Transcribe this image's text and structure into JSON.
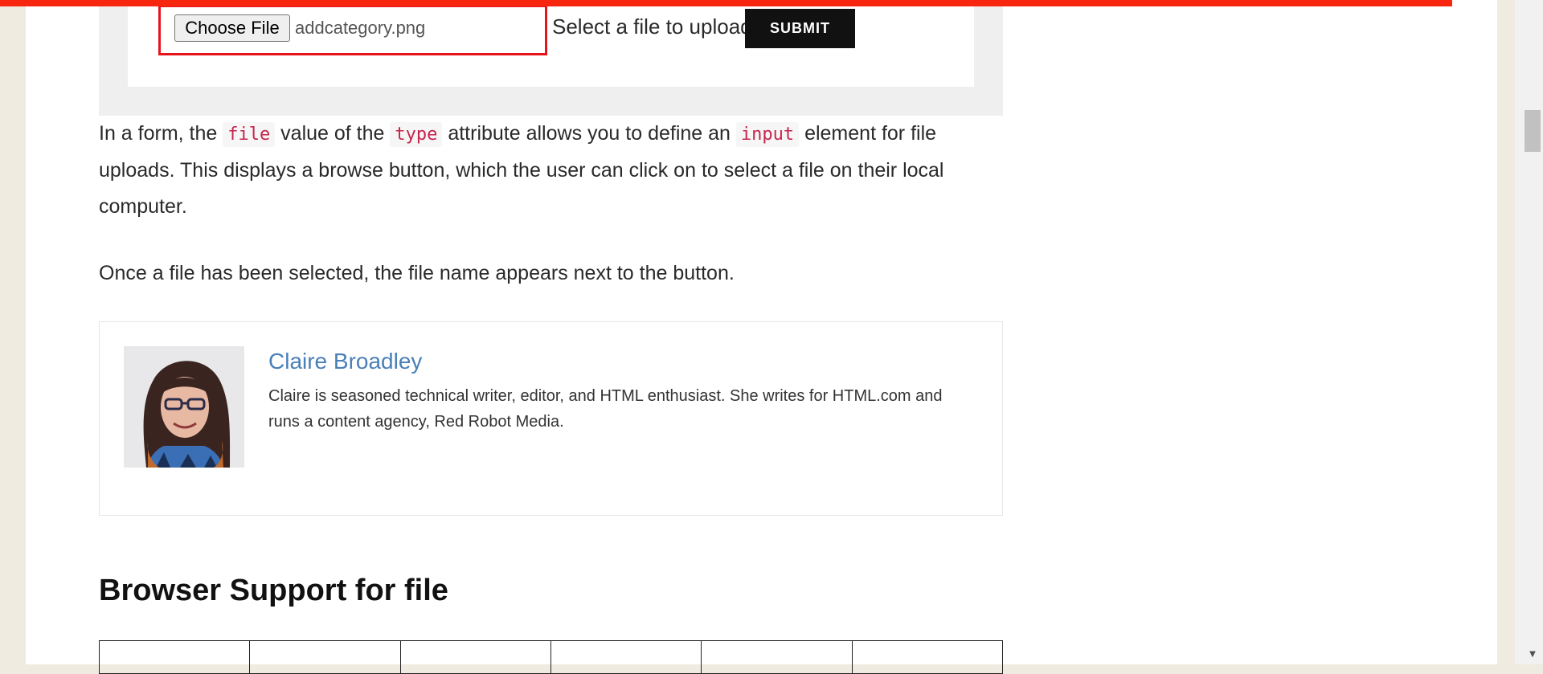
{
  "demo": {
    "choose_file_label": "Choose File",
    "file_name": "addcategory.png",
    "upload_label": "Select a file to upload",
    "submit_label": "SUBMIT"
  },
  "article": {
    "para1": {
      "t1": "In a form, the ",
      "c1": "file",
      "t2": " value of the ",
      "c2": "type",
      "t3": " attribute allows you to define an ",
      "c3": "input",
      "t4": " element for file uploads. This displays a browse button, which the user can click on to select a file on their local computer."
    },
    "para2": "Once a file has been selected, the file name appears next to the button."
  },
  "author": {
    "name": "Claire Broadley",
    "bio": "Claire is seasoned technical writer, editor, and HTML enthusiast. She writes for HTML.com and runs a content agency, Red Robot Media."
  },
  "section": {
    "heading": "Browser Support for file"
  },
  "table": {
    "columns": 6
  },
  "colors": {
    "progress": "#f8250f",
    "highlight_border": "#e5141b",
    "link": "#4a7fb8",
    "code": "#c7254e"
  },
  "icons": {
    "scroll_down": "triangle-down"
  }
}
